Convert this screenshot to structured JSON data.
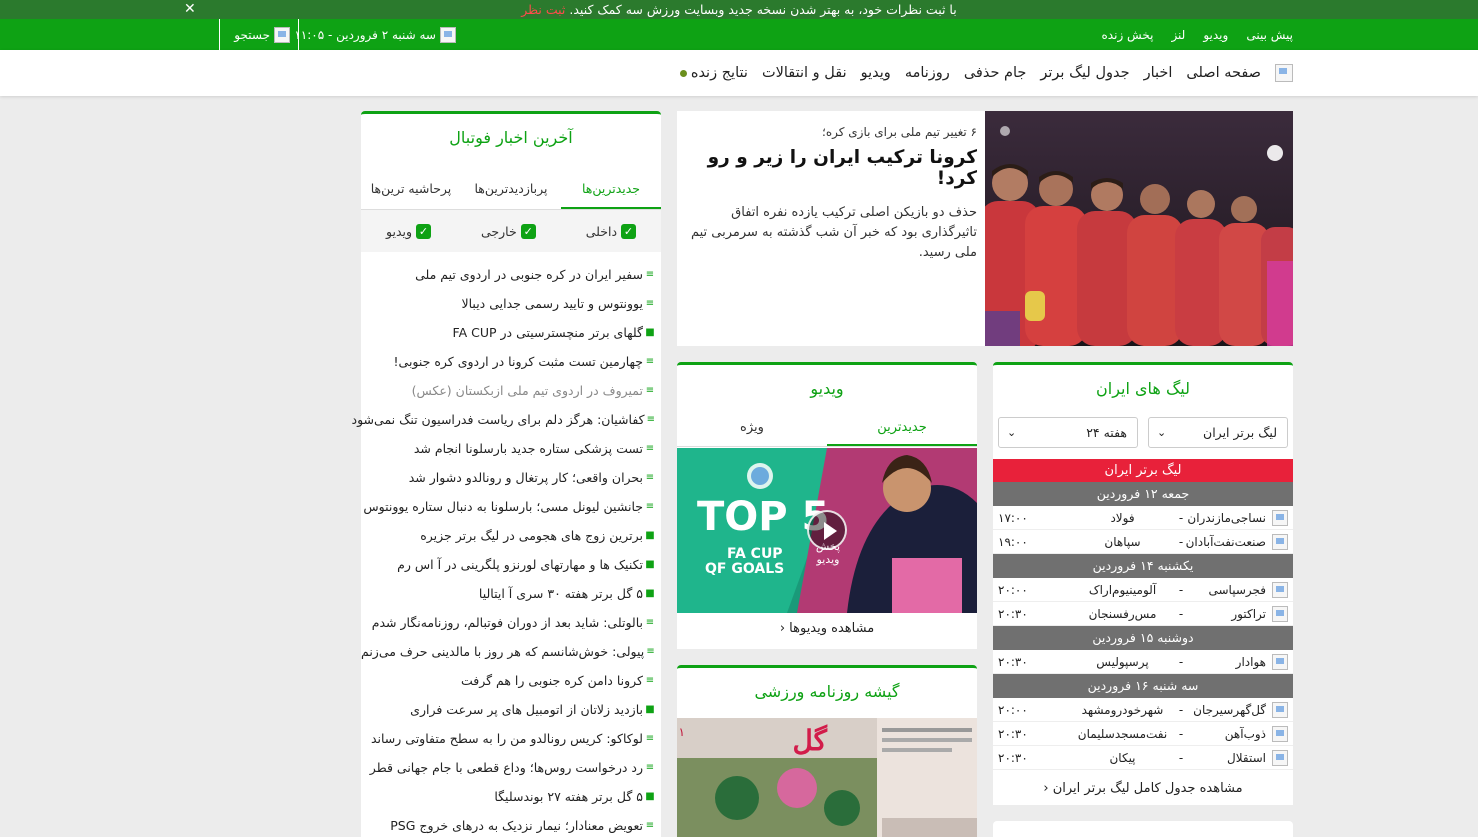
{
  "notice": {
    "text": "با ثبت نظرات خود، به بهتر شدن نسخه جدید وبسایت ورزش سه کمک کنید.",
    "link": "ثبت نظر",
    "close": "✕"
  },
  "topbar": {
    "links": [
      "پیش بینی",
      "ویدیو",
      "لنز",
      "پخش زنده"
    ],
    "date": "سه شنبه ۲ فروردین - ۱۱:۰۵",
    "search": "جستجو"
  },
  "nav": {
    "items": [
      "صفحه اصلی",
      "اخبار",
      "جدول لیگ برتر",
      "جام حذفی",
      "روزنامه",
      "ویدیو",
      "نقل و انتقالات",
      "نتایج زنده"
    ]
  },
  "hero": {
    "subtitle": "۶ تغییر تیم ملی برای بازی کره؛",
    "title": "کرونا ترکیب ایران را زیر و رو کرد!",
    "desc": "حذف دو بازیکن اصلی ترکیب یازده نفره اتفاق تاثیرگذاری بود که خبر آن شب گذشته به سرمربی تیم ملی رسید."
  },
  "news": {
    "title": "آخرین اخبار فوتبال",
    "tabs": [
      "جدیدترین‌ها",
      "پربازدیدترین‌ها",
      "پرحاشیه ترین‌ها"
    ],
    "filters": [
      "داخلی",
      "خارجی",
      "ویدیو"
    ],
    "items": [
      {
        "t": "سفیر ایران در کره جنوبی در اردوی تیم ملی",
        "k": "text"
      },
      {
        "t": "یوونتوس و تایید رسمی جدایی دیبالا",
        "k": "text"
      },
      {
        "t": "گلهای برتر منچسترسیتی در FA CUP",
        "k": "video"
      },
      {
        "t": "چهارمین تست مثبت کرونا در اردوی کره جنوبی!",
        "k": "text"
      },
      {
        "t": "تمیروف در اردوی تیم ملی ازبکستان (عکس)",
        "k": "text",
        "muted": true
      },
      {
        "t": "کفاشیان: هرگز دلم برای ریاست فدراسیون تنگ نمی‌شود",
        "k": "text"
      },
      {
        "t": "تست پزشکی ستاره جدید بارسلونا انجام شد",
        "k": "text"
      },
      {
        "t": "بحران واقعی؛ کار پرتغال و رونالدو دشوار شد",
        "k": "text"
      },
      {
        "t": "جانشین لیونل مسی؛ بارسلونا به دنبال ستاره یوونتوس",
        "k": "text"
      },
      {
        "t": "برترین زوج های هجومی در لیگ برتر جزیره",
        "k": "video"
      },
      {
        "t": "تکنیک ها و مهارتهای لورنزو پلگرینی در آ اس رم",
        "k": "video"
      },
      {
        "t": "۵ گل برتر هفته ۳۰ سری آ ایتالیا",
        "k": "video"
      },
      {
        "t": "بالوتلی: شاید بعد از دوران فوتبالم، روزنامه‌نگار شدم",
        "k": "text"
      },
      {
        "t": "پیولی: خوش‌شانسم که هر روز با مالدینی حرف می‌زنم",
        "k": "text"
      },
      {
        "t": "کرونا دامن کره جنوبی را هم گرفت",
        "k": "text"
      },
      {
        "t": "بازدید زلاتان از اتومبیل های پر سرعت فراری",
        "k": "video"
      },
      {
        "t": "لوکاکو: کریس رونالدو من را به سطح متفاوتی رساند",
        "k": "text"
      },
      {
        "t": "رد درخواست روس‌ها؛ وداع قطعی با جام جهانی قطر",
        "k": "text"
      },
      {
        "t": "۵ گل برتر هفته ۲۷ بوندسلیگا",
        "k": "video"
      },
      {
        "t": "تعویض معنادار؛ نیمار نزدیک به درهای خروج PSG",
        "k": "text"
      }
    ]
  },
  "video": {
    "title": "ویدیو",
    "tabs": [
      "جدیدترین",
      "ویژه"
    ],
    "thumb_text": {
      "top": "TOP 5",
      "sub1": "FA CUP",
      "sub2": "QF GOALS",
      "play": "پخش ویدیو"
    },
    "more": "مشاهده ویدیوها"
  },
  "paper": {
    "title": "گیشه روزنامه ورزشی"
  },
  "league": {
    "title": "لیگ های ایران",
    "select_league": "لیگ برتر ایران",
    "select_week": "هفته ۲۴",
    "header": "لیگ برتر ایران",
    "days": [
      {
        "label": "جمعه ۱۲ فروردین",
        "matches": [
          {
            "home": "نساجی‌مازندران",
            "away": "فولاد",
            "time": "۱۷:۰۰"
          },
          {
            "home": "صنعت‌نفت‌آبادان",
            "away": "سپاهان",
            "time": "۱۹:۰۰"
          }
        ]
      },
      {
        "label": "یکشنبه ۱۴ فروردین",
        "matches": [
          {
            "home": "فجرسپاسی",
            "away": "آلومینیوم‌اراک",
            "time": "۲۰:۰۰"
          },
          {
            "home": "تراکتور",
            "away": "مس‌رفسنجان",
            "time": "۲۰:۳۰"
          }
        ]
      },
      {
        "label": "دوشنبه ۱۵ فروردین",
        "matches": [
          {
            "home": "هوادار",
            "away": "پرسپولیس",
            "time": "۲۰:۳۰"
          }
        ]
      },
      {
        "label": "سه شنبه ۱۶ فروردین",
        "matches": [
          {
            "home": "گل‌گهرسیرجان",
            "away": "شهرخودرومشهد",
            "time": "۲۰:۰۰"
          },
          {
            "home": "ذوب‌آهن",
            "away": "نفت‌مسجدسلیمان",
            "time": "۲۰:۳۰"
          },
          {
            "home": "استقلال",
            "away": "پیکان",
            "time": "۲۰:۳۰"
          }
        ]
      }
    ],
    "more": "مشاهده جدول کامل لیگ برتر ایران"
  },
  "colors": {
    "brand_green": "#0ea214",
    "dark_green": "#2b7a2d",
    "league_red": "#e8213a"
  }
}
